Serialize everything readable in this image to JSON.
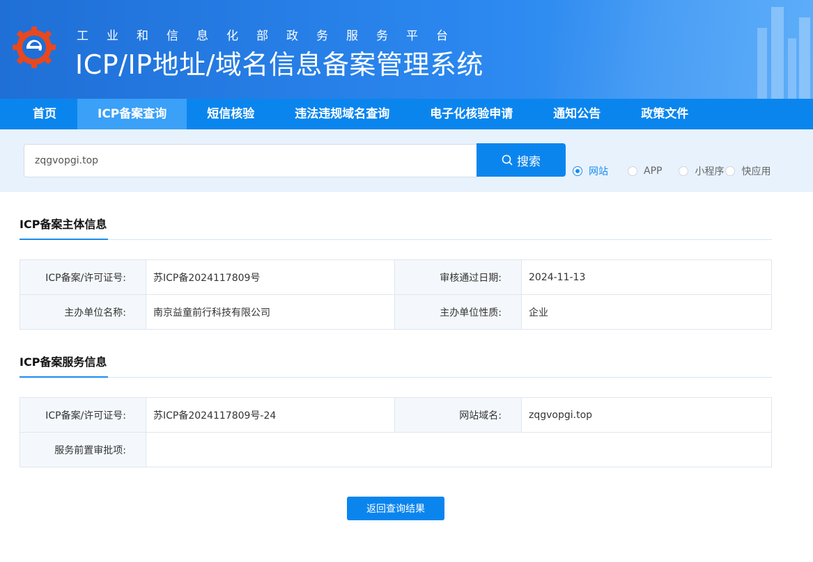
{
  "header": {
    "subtitle": "工业和信息化部政务服务平台",
    "title": "ICP/IP地址/域名信息备案管理系统"
  },
  "nav": {
    "items": [
      {
        "label": "首页"
      },
      {
        "label": "ICP备案查询"
      },
      {
        "label": "短信核验"
      },
      {
        "label": "违法违规域名查询"
      },
      {
        "label": "电子化核验申请"
      },
      {
        "label": "通知公告"
      },
      {
        "label": "政策文件"
      }
    ],
    "active_index": 1
  },
  "search": {
    "value": "zqgvopgi.top",
    "button_label": "搜索",
    "options": [
      {
        "label": "网站",
        "checked": true
      },
      {
        "label": "APP",
        "checked": false
      },
      {
        "label": "小程序",
        "checked": false
      },
      {
        "label": "快应用",
        "checked": false
      }
    ]
  },
  "entity_section": {
    "title": "ICP备案主体信息",
    "license_label": "ICP备案/许可证号:",
    "license_value": "苏ICP备2024117809号",
    "approval_date_label": "审核通过日期:",
    "approval_date_value": "2024-11-13",
    "org_name_label": "主办单位名称:",
    "org_name_value": "南京益童前行科技有限公司",
    "org_type_label": "主办单位性质:",
    "org_type_value": "企业"
  },
  "service_section": {
    "title": "ICP备案服务信息",
    "license_label": "ICP备案/许可证号:",
    "license_value": "苏ICP备2024117809号-24",
    "domain_label": "网站域名:",
    "domain_value": "zqgvopgi.top",
    "pre_approval_label": "服务前置审批项:",
    "pre_approval_value": ""
  },
  "return_button": "返回查询结果",
  "colors": {
    "primary": "#0b85ee",
    "nav_active": "#3aa0f8",
    "search_bg": "#e7f2fd"
  }
}
